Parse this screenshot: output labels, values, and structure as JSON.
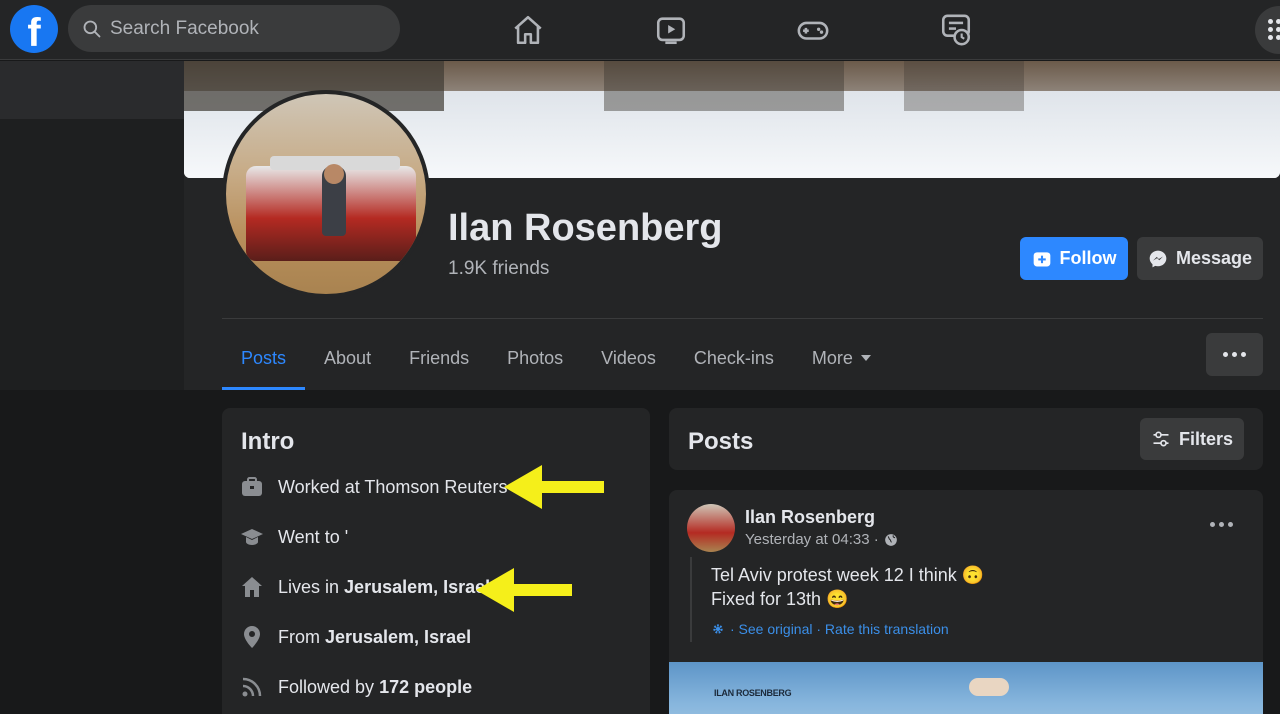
{
  "search": {
    "placeholder": "Search Facebook"
  },
  "profile": {
    "name": "Ilan Rosenberg",
    "friends": "1.9K friends",
    "follow_label": "Follow",
    "message_label": "Message"
  },
  "tabs": [
    {
      "label": "Posts",
      "active": true
    },
    {
      "label": "About"
    },
    {
      "label": "Friends"
    },
    {
      "label": "Photos"
    },
    {
      "label": "Videos"
    },
    {
      "label": "Check-ins"
    },
    {
      "label": "More"
    }
  ],
  "intro": {
    "title": "Intro",
    "work": "Worked at Thomson Reuters",
    "education": "Went to '",
    "lives_prefix": "Lives in ",
    "lives_place": "Jerusalem, Israel",
    "from_prefix": "From ",
    "from_place": "Jerusalem, Israel",
    "followed_prefix": "Followed by ",
    "followed_count": "172 people"
  },
  "posts_header": {
    "title": "Posts",
    "filters_label": "Filters"
  },
  "post": {
    "author": "Ilan Rosenberg",
    "time": "Yesterday at 04:33 ·",
    "line1": "Tel Aviv protest week 12 I think 🙃",
    "line2": "Fixed for 13th 😄",
    "translation": "· See original · Rate this translation",
    "watermark": "ILAN ROSENBERG"
  },
  "colors": {
    "accent": "#2d88ff",
    "annotation_arrow": "#f5ef1a",
    "background": "#18191a",
    "card": "#242526"
  },
  "icons": [
    "facebook-logo-icon",
    "search-icon",
    "home-icon",
    "watch-icon",
    "gaming-icon",
    "memories-icon",
    "menu-grid-icon"
  ]
}
